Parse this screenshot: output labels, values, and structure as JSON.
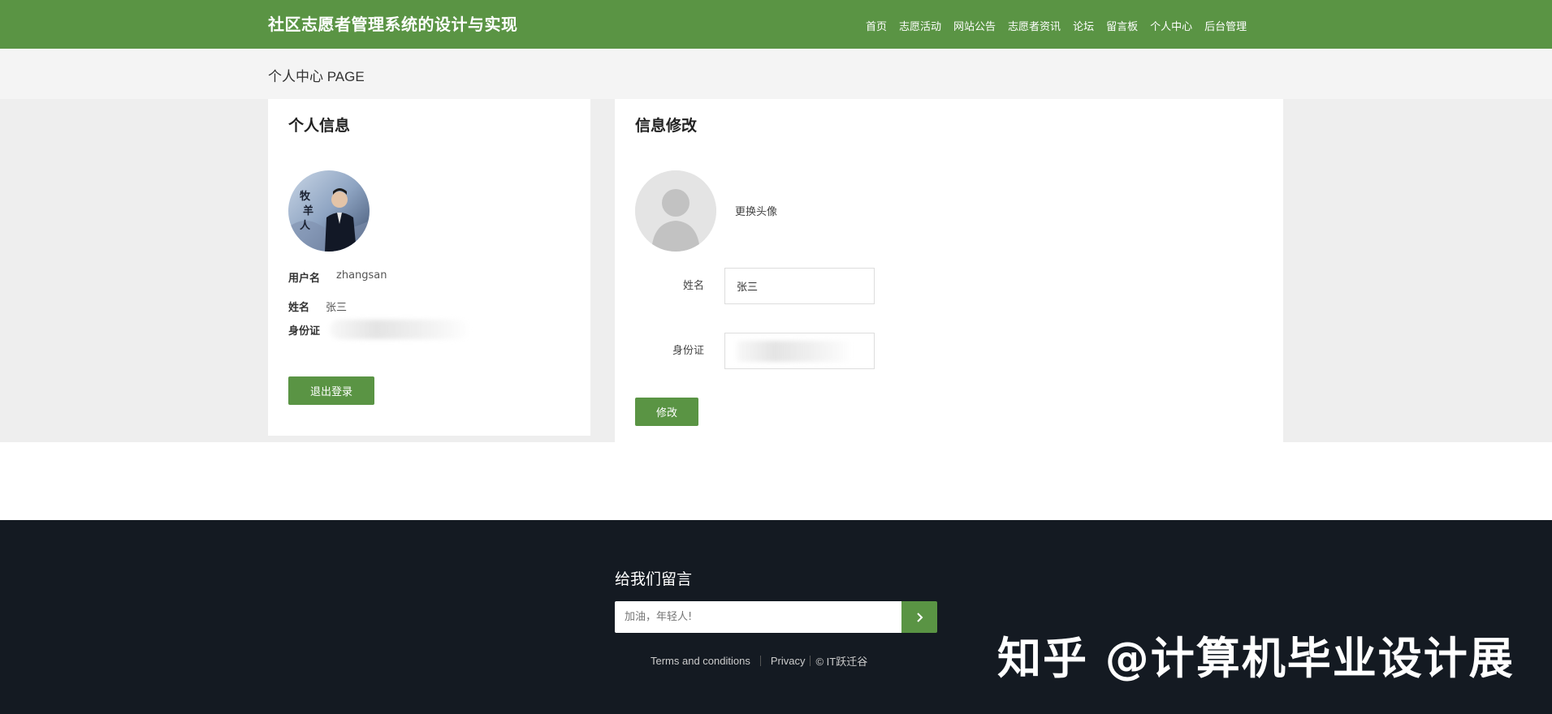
{
  "header": {
    "site_title": "社区志愿者管理系统的设计与实现",
    "nav": [
      "首页",
      "志愿活动",
      "网站公告",
      "志愿者资讯",
      "论坛",
      "留言板",
      "个人中心",
      "后台管理"
    ]
  },
  "breadcrumb": {
    "text": "个人中心 PAGE"
  },
  "profile_card": {
    "title": "个人信息",
    "username_label": "用户名",
    "username_value": "zhangsan",
    "name_label": "姓名",
    "name_value": "张三",
    "id_label": "身份证",
    "logout_label": "退出登录"
  },
  "edit_card": {
    "title": "信息修改",
    "change_avatar": "更换头像",
    "name_label": "姓名",
    "name_value": "张三",
    "id_label": "身份证",
    "submit_label": "修改"
  },
  "footer": {
    "title": "给我们留言",
    "input_placeholder": "加油，年轻人!",
    "links": [
      "Terms and conditions",
      "Privacy",
      "© IT跃迁谷"
    ],
    "watermark": "知乎 @计算机毕业设计展"
  },
  "colors": {
    "brand_green": "#5a9444",
    "footer_bg": "#141a22"
  },
  "icons": {
    "submit": "chevron-right-icon"
  }
}
